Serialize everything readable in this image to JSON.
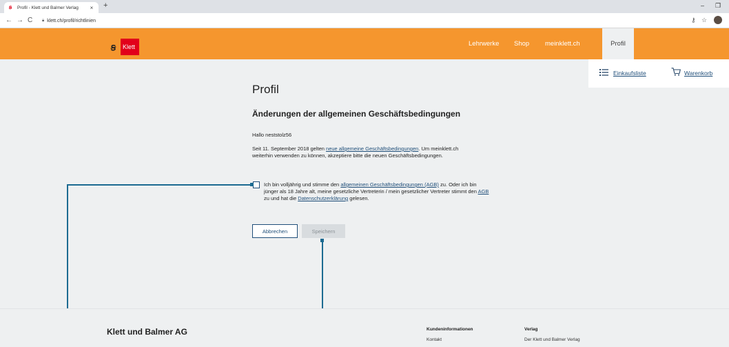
{
  "browser": {
    "tab_title": "Profil - Klett und Balmer Verlag",
    "tab_favicon": "klett-logo-icon",
    "tab_close": "×",
    "new_tab": "+",
    "url": "klett.ch/profil/richtlinien",
    "back": "←",
    "forward": "→",
    "reload": "C",
    "key_icon": "⚷",
    "star_icon": "☆",
    "minimize": "–",
    "restore": "❐"
  },
  "header": {
    "logo_mark": "ꞩ",
    "logo_text": "Klett",
    "brand_color": "#f5962e",
    "nav": [
      {
        "label": "Lehrwerke"
      },
      {
        "label": "Shop"
      },
      {
        "label": "meinklett.ch"
      },
      {
        "label": "Profil",
        "active": true
      }
    ]
  },
  "tools": {
    "list_icon": "list-icon",
    "list_label": "Einkaufsliste",
    "cart_icon": "cart-icon",
    "cart_label": "Warenkorb"
  },
  "main": {
    "title": "Profil",
    "subtitle": "Änderungen der allgemeinen Geschäftsbedingungen",
    "greeting": "Hallo neststolz56",
    "para_1": "Seit 11. September 2018 gelten ",
    "para_link": "neue allgemeine Geschäftsbedingungen",
    "para_2": ". Um meinklett.ch weiterhin verwenden zu können, akzeptiere bitte die neuen Geschäftsbedingungen.",
    "agb_1": "Ich bin volljährig und stimme den ",
    "agb_link_1": "allgemeinen Geschäftsbedingungen (AGB)",
    "agb_2": " zu. Oder ich bin jünger als 18 Jahre alt, meine gesetzliche Vertreterin / mein gesetzlicher Vertreter stimmt den ",
    "agb_link_2": "AGB",
    "agb_3": " zu und hat die ",
    "agb_link_3": "Datenschutzerklärung",
    "agb_4": " gelesen.",
    "checkbox_checked": false,
    "cancel_label": "Abbrechen",
    "save_label": "Speichern",
    "save_enabled": false
  },
  "footer": {
    "company": "Klett und Balmer AG",
    "col1_head": "Kundeninformationen",
    "col1_link": "Kontakt",
    "col2_head": "Verlag",
    "col2_link": "Der Klett und Balmer Verlag"
  }
}
